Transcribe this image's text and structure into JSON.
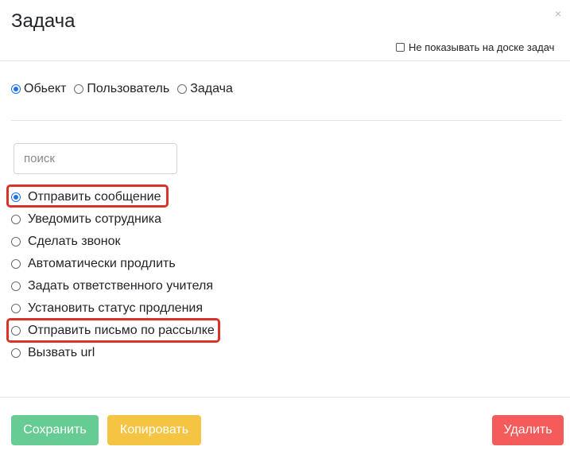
{
  "modal": {
    "title": "Задача",
    "close_symbol": "×",
    "hide_board_label": "Не показывать на доске задач"
  },
  "entity_types": [
    {
      "label": "Обьект",
      "checked": true
    },
    {
      "label": "Пользователь",
      "checked": false
    },
    {
      "label": "Задача",
      "checked": false
    }
  ],
  "search": {
    "placeholder": "поиск",
    "value": ""
  },
  "actions": [
    {
      "label": "Отправить сообщение",
      "checked": true,
      "highlighted": true
    },
    {
      "label": "Уведомить сотрудника",
      "checked": false,
      "highlighted": false
    },
    {
      "label": "Сделать звонок",
      "checked": false,
      "highlighted": false
    },
    {
      "label": "Автоматически продлить",
      "checked": false,
      "highlighted": false
    },
    {
      "label": "Задать ответственного учителя",
      "checked": false,
      "highlighted": false
    },
    {
      "label": "Установить статус продления",
      "checked": false,
      "highlighted": false
    },
    {
      "label": "Отправить письмо по рассылке",
      "checked": false,
      "highlighted": true
    },
    {
      "label": "Вызвать url",
      "checked": false,
      "highlighted": false
    }
  ],
  "buttons": {
    "save": "Сохранить",
    "copy": "Копировать",
    "delete": "Удалить"
  },
  "colors": {
    "save": "#66cc94",
    "copy": "#f6c443",
    "delete": "#f45b5b",
    "highlight": "#d9342b",
    "radio_checked": "#1a73e8"
  }
}
